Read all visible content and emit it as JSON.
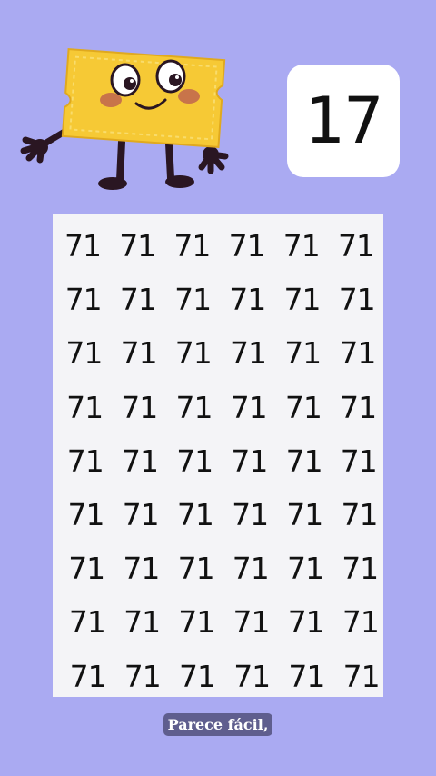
{
  "colors": {
    "background": "#aaaaf2",
    "card": "#ffffff",
    "grid_card": "#f4f4f7",
    "ticket_yellow": "#f6c935",
    "caption_bg": "#5f5e8e"
  },
  "mascot": {
    "icon": "ticket-character-icon"
  },
  "target": {
    "number": "17"
  },
  "grid": {
    "rows": [
      [
        "71",
        "71",
        "71",
        "71",
        "71",
        "71"
      ],
      [
        "71",
        "71",
        "71",
        "71",
        "71",
        "71"
      ],
      [
        "71",
        "71",
        "71",
        "71",
        "71",
        "71"
      ],
      [
        "71",
        "71",
        "71",
        "71",
        "71",
        "71"
      ],
      [
        "71",
        "71",
        "71",
        "71",
        "71",
        "71"
      ],
      [
        "71",
        "71",
        "71",
        "71",
        "71",
        "71"
      ],
      [
        "71",
        "71",
        "71",
        "71",
        "71",
        "71"
      ],
      [
        "71",
        "71",
        "71",
        "71",
        "71",
        "71"
      ],
      [
        "71",
        "71",
        "71",
        "71",
        "71",
        "71"
      ]
    ]
  },
  "caption": {
    "text": "Parece fácil,"
  }
}
